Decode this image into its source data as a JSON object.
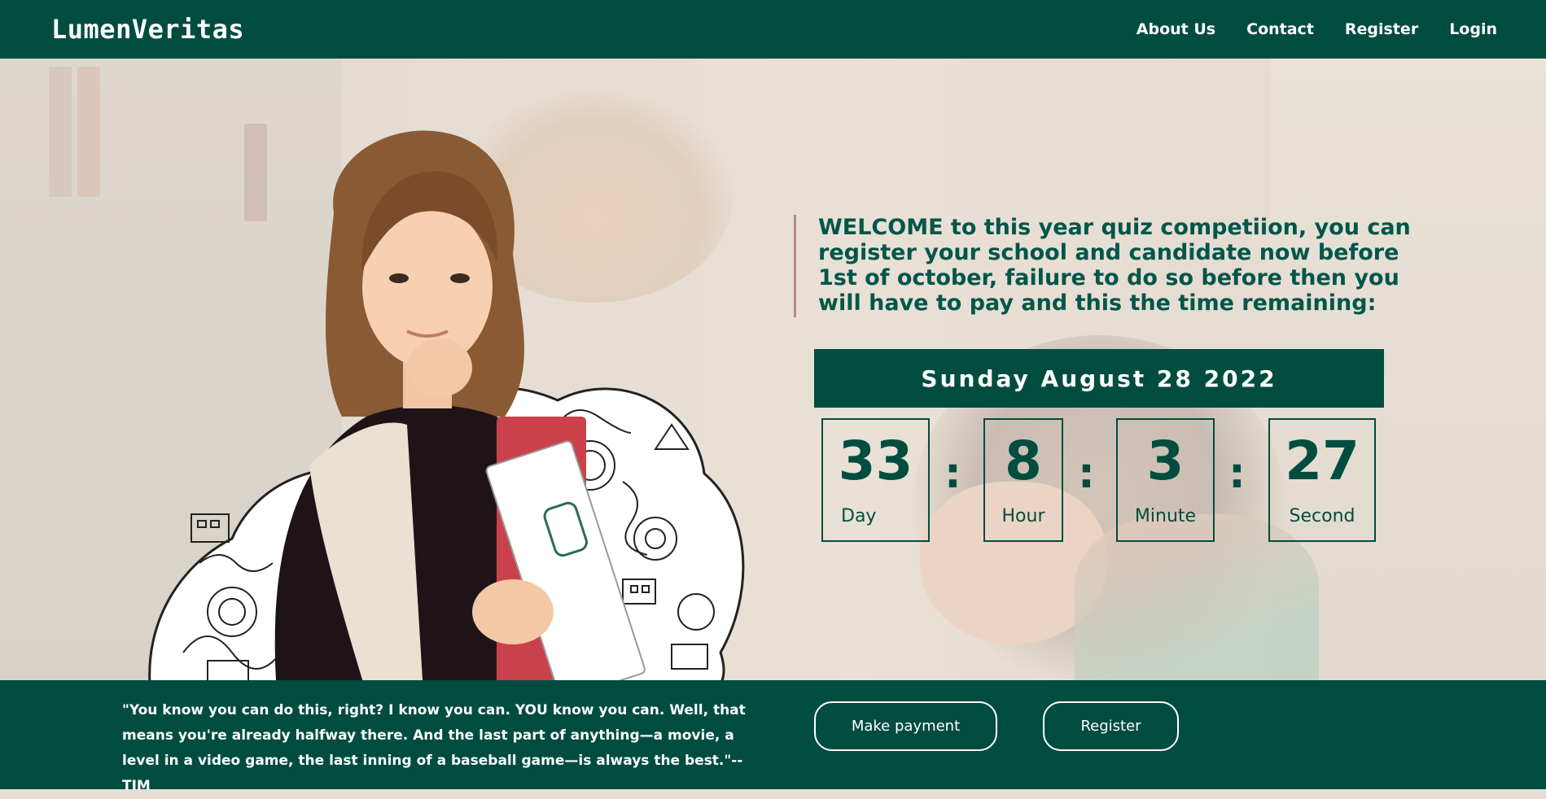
{
  "header": {
    "brand": "LumenVeritas",
    "nav": [
      "About Us",
      "Contact",
      "Register",
      "Login"
    ]
  },
  "hero": {
    "welcome": "WELCOME to this year quiz competiion, you can register your school and candidate now before 1st of october, failure to do so before then you will have to pay and this the time remaining:",
    "date": "Sunday August 28 2022",
    "countdown": {
      "days": "33",
      "days_label": "Day",
      "hours": "8",
      "hours_label": "Hour",
      "minutes": "3",
      "minutes_label": "Minute",
      "seconds": "27",
      "seconds_label": "Second",
      "separator": ":"
    }
  },
  "footer": {
    "quote": "\"You know you can do this, right? I know you can. YOU know you can. Well, that means you're already halfway there. And the last part of anything—a movie, a level in a video game, the last inning of a baseball game—is always the best.\"-- TIM",
    "payment_button": "Make payment",
    "register_button": "Register"
  },
  "colors": {
    "primary": "#004d40",
    "welcome_text": "#00564a",
    "background": "#e6ded4",
    "accent_line": "#b98a7d"
  }
}
